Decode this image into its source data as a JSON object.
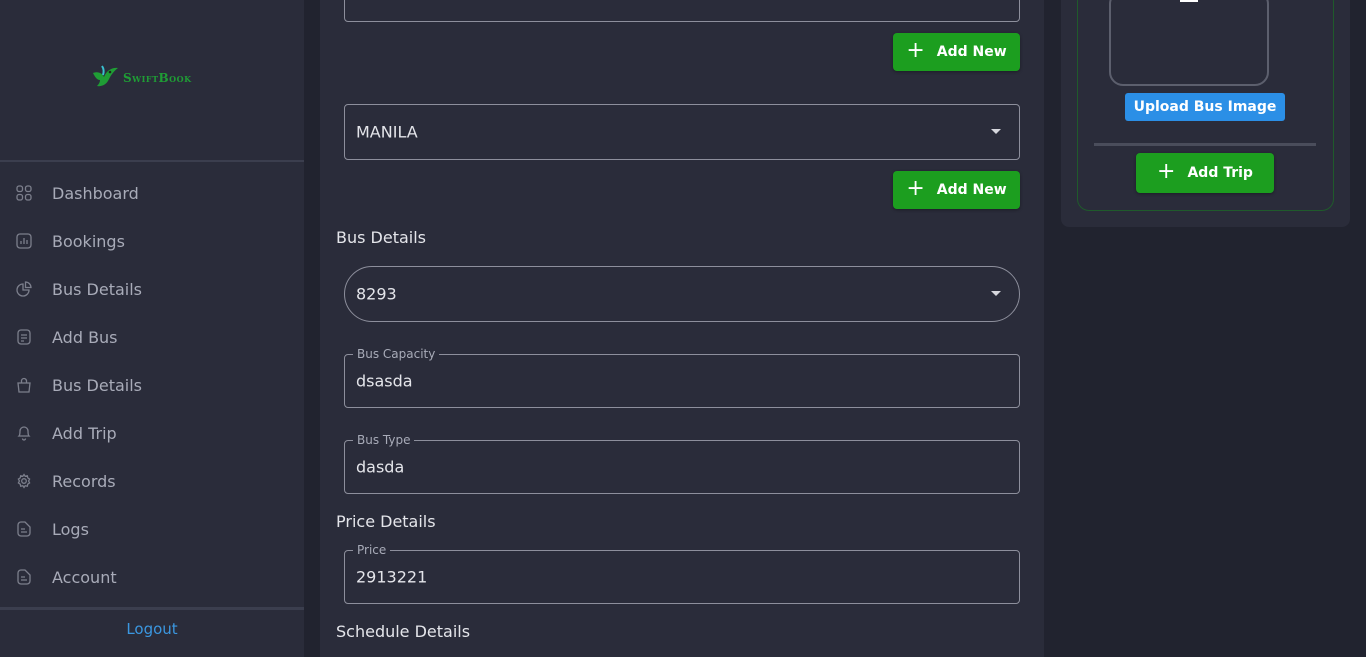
{
  "app": {
    "logo_text": "SwiftBook"
  },
  "sidebar": {
    "items": [
      {
        "label": "Dashboard",
        "icon": "grid-icon"
      },
      {
        "label": "Bookings",
        "icon": "chart-icon"
      },
      {
        "label": "Bus Details",
        "icon": "pie-icon"
      },
      {
        "label": "Add Bus",
        "icon": "document-icon"
      },
      {
        "label": "Bus Details",
        "icon": "bag-icon"
      },
      {
        "label": "Add Trip",
        "icon": "bell-icon"
      },
      {
        "label": "Records",
        "icon": "gear-icon"
      },
      {
        "label": "Logs",
        "icon": "file-icon"
      },
      {
        "label": "Account",
        "icon": "file-icon"
      }
    ],
    "logout_label": "Logout"
  },
  "form": {
    "add_new_label": "Add New",
    "route_select": {
      "value": "MANILA"
    },
    "bus_details_title": "Bus Details",
    "bus_number_select": {
      "value": "8293"
    },
    "bus_capacity": {
      "label": "Bus Capacity",
      "value": "dsasda"
    },
    "bus_type": {
      "label": "Bus Type",
      "value": "dasda"
    },
    "price_details_title": "Price Details",
    "price": {
      "label": "Price",
      "value": "2913221"
    },
    "schedule_details_title": "Schedule Details"
  },
  "right_panel": {
    "upload_label": "Upload Bus Image",
    "add_trip_label": "Add Trip"
  },
  "colors": {
    "accent_green": "#1c9e1f",
    "accent_blue": "#2b8fe6",
    "background": "#21232f",
    "panel": "#2a2c3a"
  }
}
